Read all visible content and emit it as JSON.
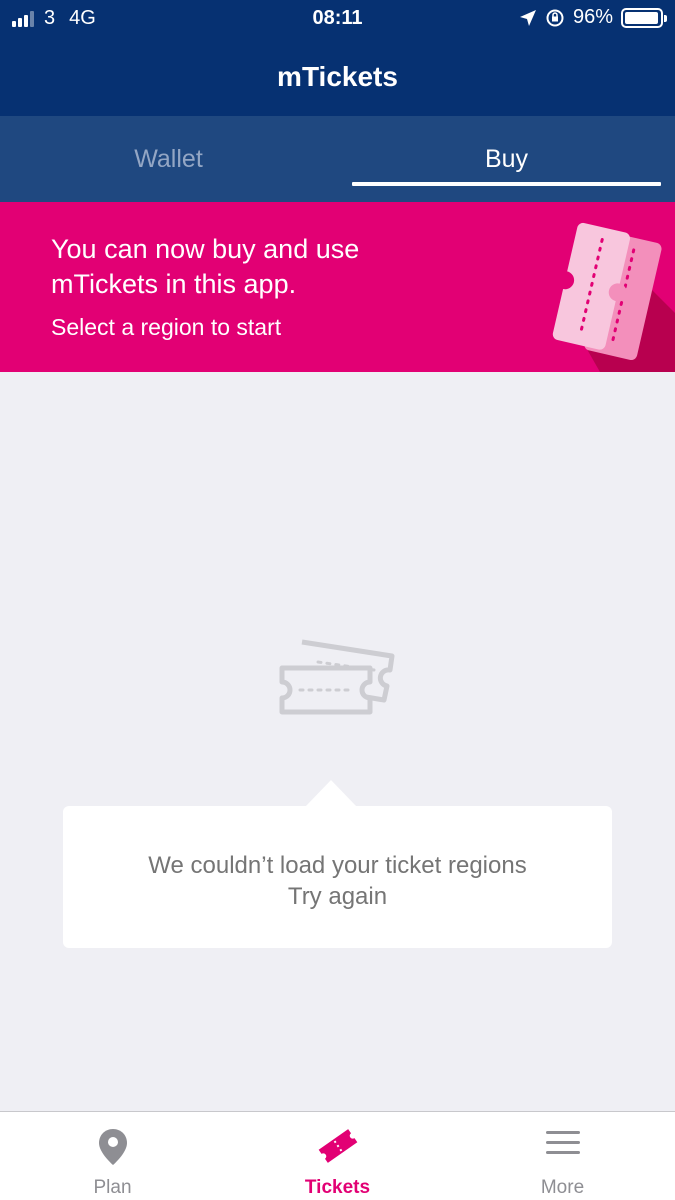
{
  "status_bar": {
    "carrier": "3",
    "network": "4G",
    "time": "08:11",
    "battery": "96%",
    "battery_level": 0.96
  },
  "header": {
    "title": "mTickets"
  },
  "tabs": [
    {
      "label": "Wallet",
      "selected": false
    },
    {
      "label": "Buy",
      "selected": true
    }
  ],
  "promo": {
    "headline": "You can now buy and use mTickets in this app.",
    "subtext": "Select a region to start"
  },
  "error": {
    "message": "We couldn’t load your ticket regions",
    "retry_label": "Try again"
  },
  "bottom_nav": [
    {
      "label": "Plan",
      "icon": "map-pin-icon",
      "active": false
    },
    {
      "label": "Tickets",
      "icon": "ticket-icon",
      "active": true
    },
    {
      "label": "More",
      "icon": "menu-icon",
      "active": false
    }
  ],
  "colors": {
    "header": "#063172",
    "tabbar": "#1f4880",
    "accent": "#e20074",
    "background": "#efeff4"
  }
}
